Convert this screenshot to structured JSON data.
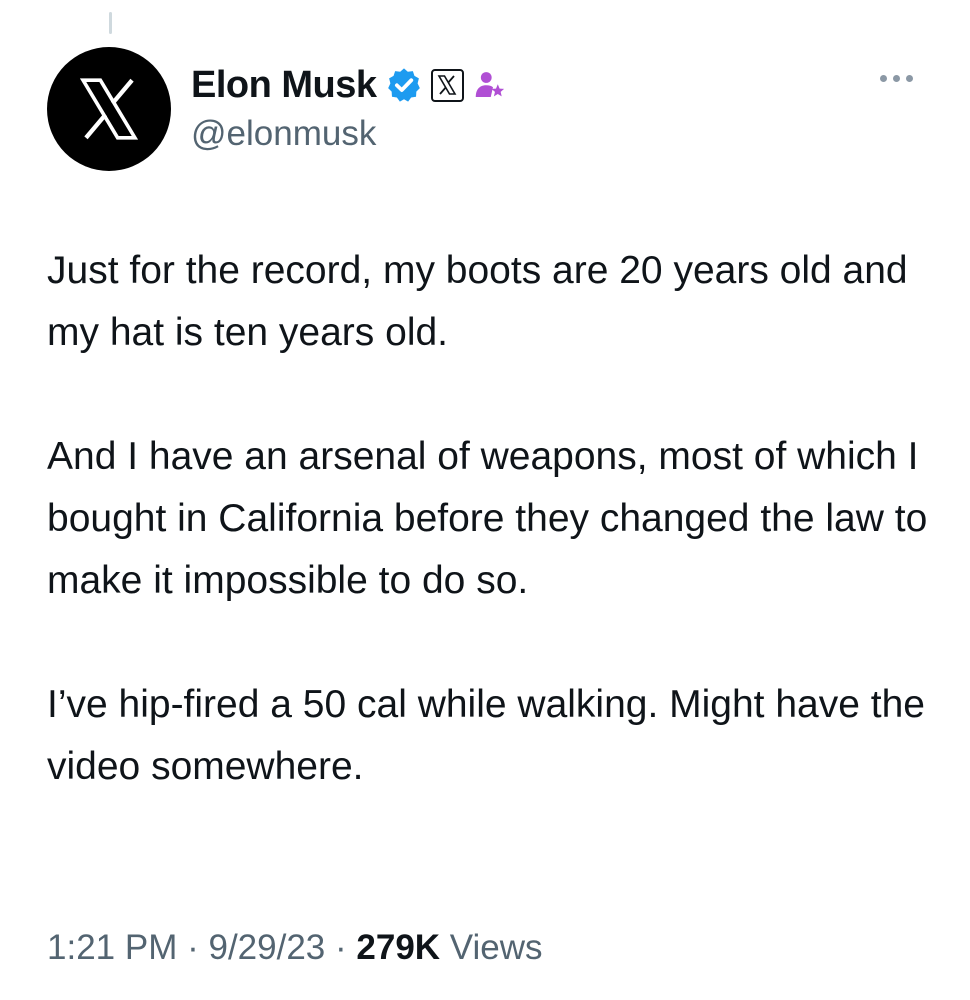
{
  "author": {
    "display_name": "Elon Musk",
    "handle": "@elonmusk",
    "avatar_icon": "x-logo-icon",
    "badges": [
      "verified-badge-icon",
      "x-affiliate-badge-icon",
      "subscriber-star-icon"
    ]
  },
  "tweet": {
    "paragraphs": [
      "Just for the record, my boots are 20 years old and my hat is ten years old.",
      "And I have an arsenal of weapons, most of which I bought in California before they changed the law to make it impossible to do so.",
      "I’ve hip-fired a 50 cal while walking. Might have the video somewhere."
    ]
  },
  "meta": {
    "time": "1:21 PM",
    "separator": "·",
    "date": "9/29/23",
    "views_count": "279K",
    "views_label": "Views"
  },
  "colors": {
    "text_primary": "#0f1419",
    "text_secondary": "#536471",
    "verified_blue": "#1d9bf0",
    "subscriber_purple": "#b04fd4"
  },
  "more_icon": "more-dots-icon"
}
